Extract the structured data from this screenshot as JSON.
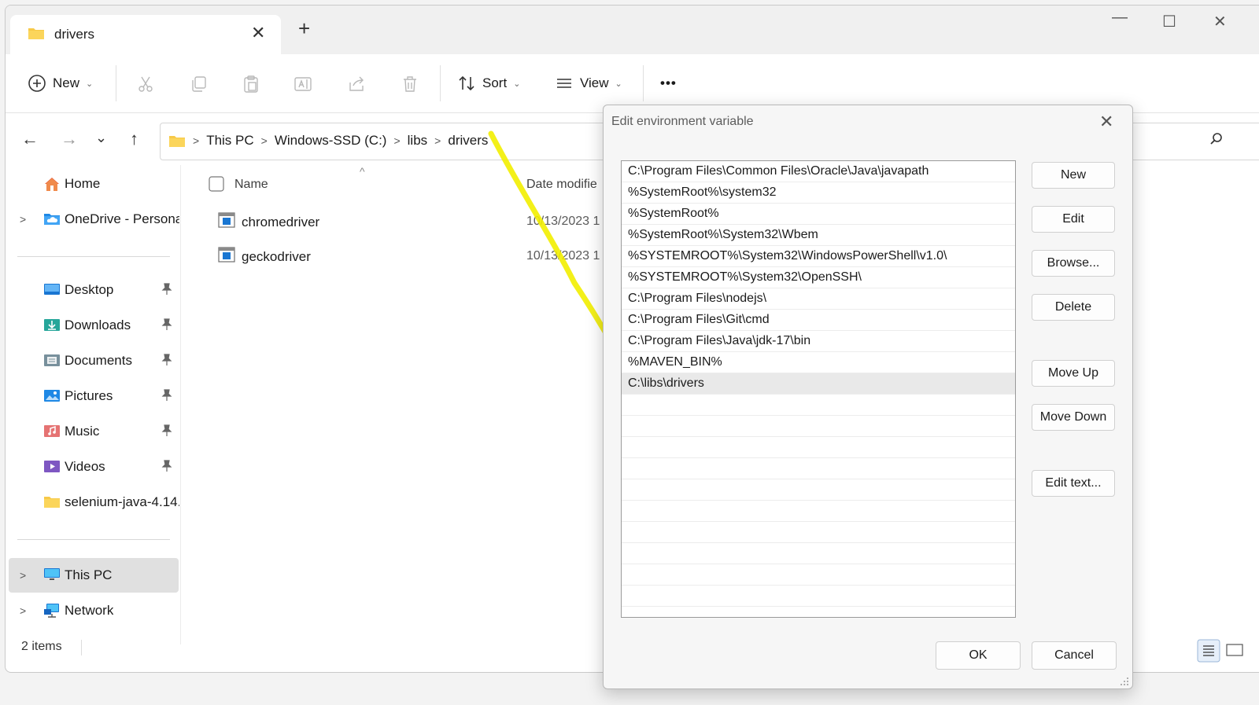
{
  "window": {
    "tab_title": "drivers",
    "tab_close": "✕",
    "new_tab": "+",
    "controls": {
      "minimize": "—",
      "maximize": "☐",
      "close": "✕"
    }
  },
  "commandbar": {
    "new_label": "New",
    "sort_label": "Sort",
    "view_label": "View",
    "more_label": "•••",
    "chevron": "⌄"
  },
  "nav": {
    "back": "←",
    "forward": "→",
    "recent": "⌄",
    "up": "↑"
  },
  "address": {
    "sep": ">",
    "crumbs": [
      "This PC",
      "Windows-SSD (C:)",
      "libs",
      "drivers"
    ]
  },
  "sidebar": {
    "home": "Home",
    "onedrive": "OneDrive - Persona",
    "pinned": [
      "Desktop",
      "Downloads",
      "Documents",
      "Pictures",
      "Music",
      "Videos",
      "selenium-java-4.14."
    ],
    "this_pc": "This PC",
    "network": "Network",
    "expander": ">"
  },
  "filelist": {
    "col_name": "Name",
    "col_date": "Date modifie",
    "sort_arrow": "^",
    "files": [
      {
        "name": "chromedriver",
        "date": "10/13/2023 1"
      },
      {
        "name": "geckodriver",
        "date": "10/13/2023 1"
      }
    ]
  },
  "status": {
    "items": "2 items"
  },
  "dialog": {
    "title": "Edit environment variable",
    "close": "✕",
    "paths": [
      "C:\\Program Files\\Common Files\\Oracle\\Java\\javapath",
      "%SystemRoot%\\system32",
      "%SystemRoot%",
      "%SystemRoot%\\System32\\Wbem",
      "%SYSTEMROOT%\\System32\\WindowsPowerShell\\v1.0\\",
      "%SYSTEMROOT%\\System32\\OpenSSH\\",
      "C:\\Program Files\\nodejs\\",
      "C:\\Program Files\\Git\\cmd",
      "C:\\Program Files\\Java\\jdk-17\\bin",
      "%MAVEN_BIN%",
      "C:\\libs\\drivers"
    ],
    "selected_index": 10,
    "buttons": {
      "new": "New",
      "edit": "Edit",
      "browse": "Browse...",
      "delete": "Delete",
      "move_up": "Move Up",
      "move_down": "Move Down",
      "edit_text": "Edit text...",
      "ok": "OK",
      "cancel": "Cancel"
    }
  },
  "colors": {
    "highlighter": "#f2ee00",
    "folder": "#f7c948",
    "accent": "#0067c0"
  }
}
